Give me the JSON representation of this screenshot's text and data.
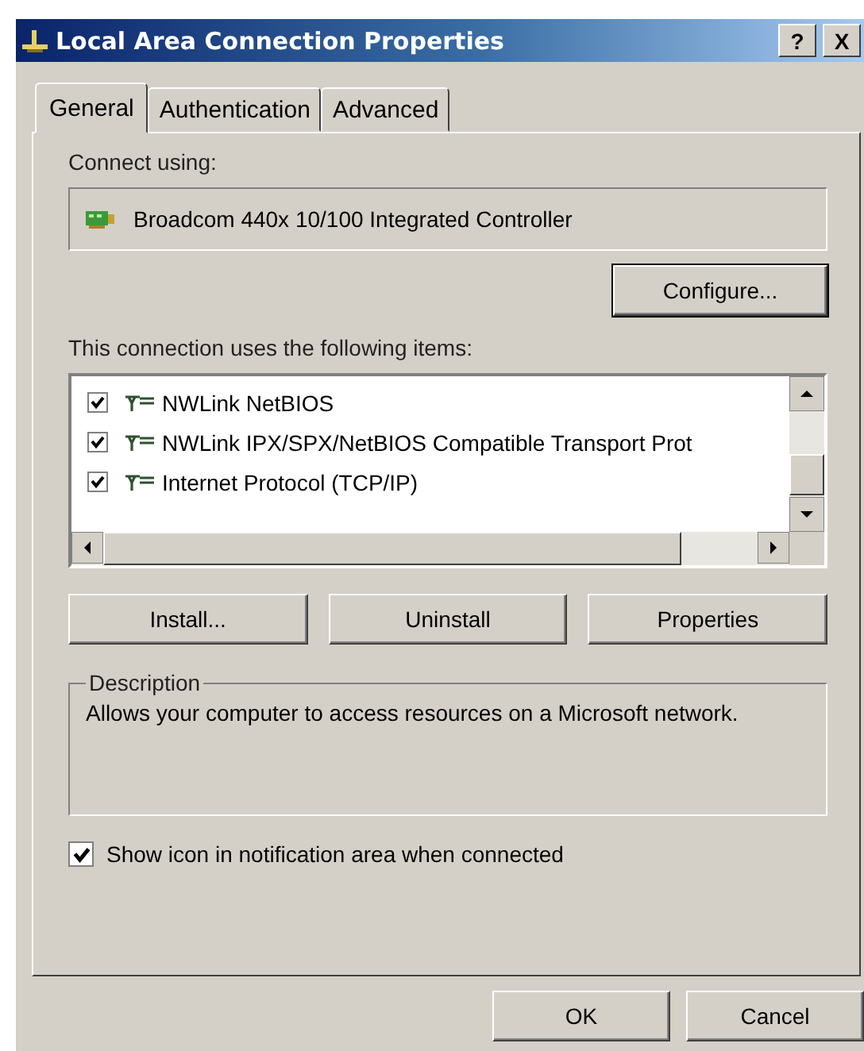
{
  "window": {
    "title": "Local Area Connection Properties",
    "help_button": "?",
    "close_button": "X"
  },
  "tabs": [
    {
      "label": "General",
      "selected": true
    },
    {
      "label": "Authentication",
      "selected": false
    },
    {
      "label": "Advanced",
      "selected": false
    }
  ],
  "connect_using": {
    "label": "Connect using:",
    "device": "Broadcom 440x 10/100 Integrated Controller",
    "configure_button": "Configure..."
  },
  "items": {
    "label": "This connection uses the following items:",
    "list": [
      {
        "name": "NWLink NetBIOS",
        "checked": true
      },
      {
        "name": "NWLink IPX/SPX/NetBIOS Compatible Transport Prot",
        "checked": true
      },
      {
        "name": "Internet Protocol (TCP/IP)",
        "checked": true
      }
    ]
  },
  "item_buttons": [
    "Install...",
    "Uninstall",
    "Properties"
  ],
  "description": {
    "label": "Description",
    "text": "Allows your computer to access resources on a Microsoft network."
  },
  "show_icon": {
    "label": "Show icon in notification area when connected",
    "checked": true
  },
  "buttons": [
    "OK",
    "Cancel"
  ]
}
